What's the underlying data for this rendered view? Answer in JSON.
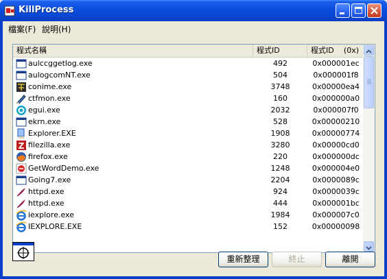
{
  "window": {
    "title": "KillProcess"
  },
  "menu": {
    "file": "檔案(F)",
    "help": "說明(H)"
  },
  "list": {
    "columns": [
      "程式名稱",
      "程式ID",
      "程式ID",
      "(0x)"
    ],
    "rows": [
      {
        "name": "aulccggetlog.exe",
        "pid": "492",
        "hex": "0x000001ec",
        "icon": "window-icon"
      },
      {
        "name": "aulogcomNT.exe",
        "pid": "504",
        "hex": "0x000001f8",
        "icon": "window-icon"
      },
      {
        "name": "conime.exe",
        "pid": "3748",
        "hex": "0x00000ea4",
        "icon": "ime-icon"
      },
      {
        "name": "ctfmon.exe",
        "pid": "160",
        "hex": "0x000000a0",
        "icon": "pen-icon"
      },
      {
        "name": "egui.exe",
        "pid": "2032",
        "hex": "0x000007f0",
        "icon": "eset-icon"
      },
      {
        "name": "ekrn.exe",
        "pid": "528",
        "hex": "0x00000210",
        "icon": "window-icon"
      },
      {
        "name": "Explorer.EXE",
        "pid": "1908",
        "hex": "0x00000774",
        "icon": "explorer-icon"
      },
      {
        "name": "filezilla.exe",
        "pid": "3280",
        "hex": "0x00000cd0",
        "icon": "filezilla-icon"
      },
      {
        "name": "firefox.exe",
        "pid": "220",
        "hex": "0x000000dc",
        "icon": "firefox-icon"
      },
      {
        "name": "GetWordDemo.exe",
        "pid": "1248",
        "hex": "0x000004e0",
        "icon": "getword-icon"
      },
      {
        "name": "Going7.exe",
        "pid": "2204",
        "hex": "0x0000089c",
        "icon": "window-icon"
      },
      {
        "name": "httpd.exe",
        "pid": "924",
        "hex": "0x0000039c",
        "icon": "feather-icon"
      },
      {
        "name": "httpd.exe",
        "pid": "444",
        "hex": "0x000001bc",
        "icon": "feather-icon"
      },
      {
        "name": "iexplore.exe",
        "pid": "1984",
        "hex": "0x000007c0",
        "icon": "ie-icon"
      },
      {
        "name": "IEXPLORE.EXE",
        "pid": "152",
        "hex": "0x00000098",
        "icon": "ie-icon"
      }
    ]
  },
  "buttons": {
    "reorganize": "重新整理",
    "terminate": "終止",
    "close": "離開"
  },
  "colors": {
    "titlebar": "#0b4fe0",
    "face": "#ece9d8",
    "close_button": "#d5543a"
  }
}
